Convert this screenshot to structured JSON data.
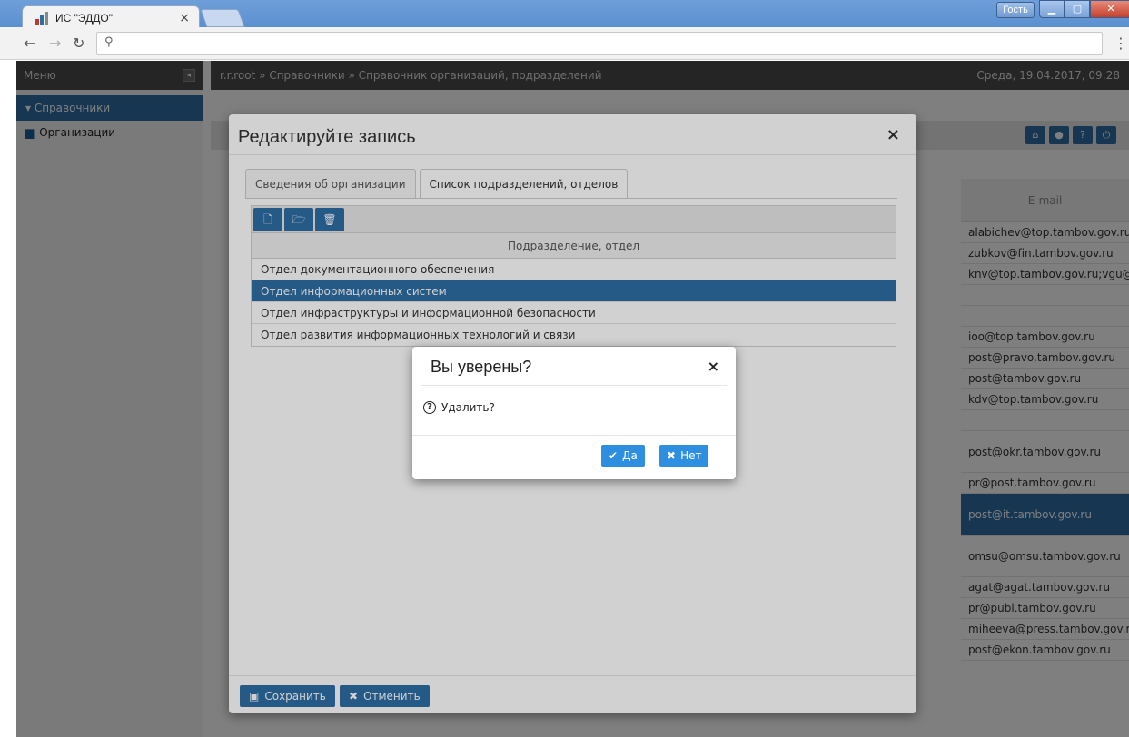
{
  "browser": {
    "tab_title": "ИС \"ЭДДО\"",
    "tab_close": "×",
    "guest": "Гость",
    "omnibox_value": ""
  },
  "sidebar": {
    "header": "Меню",
    "active_group": "▾ Справочники",
    "items": [
      {
        "label": "Организации"
      }
    ]
  },
  "header": {
    "breadcrumb": "r.r.root » Справочники » Справочник организаций, подразделений",
    "datetime": "Среда, 19.04.2017, 09:28"
  },
  "grid": {
    "email_header": "E-mail",
    "emails": [
      "alabichev@top.tambov.gov.ru",
      "zubkov@fin.tambov.gov.ru",
      "knv@top.tambov.gov.ru;vgu@to",
      "",
      "",
      "ioo@top.tambov.gov.ru",
      "post@pravo.tambov.gov.ru",
      "post@tambov.gov.ru",
      "kdv@top.tambov.gov.ru",
      "",
      "post@okr.tambov.gov.ru",
      "pr@post.tambov.gov.ru",
      "post@it.tambov.gov.ru",
      "omsu@omsu.tambov.gov.ru",
      "agat@agat.tambov.gov.ru",
      "pr@publ.tambov.gov.ru",
      "miheeva@press.tambov.gov.ru",
      "post@ekon.tambov.gov.ru"
    ]
  },
  "edit_modal": {
    "title": "Редактируйте запись",
    "close": "×",
    "tabs": [
      {
        "label": "Сведения об организации"
      },
      {
        "label": "Список подразделений, отделов"
      }
    ],
    "table_header": "Подразделение, отдел",
    "rows": [
      "Отдел документационного обеспечения",
      "Отдел информационных систем",
      "Отдел инфраструктуры и информационной безопасности",
      "Отдел развития информационных технологий и связи"
    ],
    "save": "Сохранить",
    "cancel": "Отменить"
  },
  "confirm": {
    "title": "Вы уверены?",
    "close": "×",
    "message": "Удалить?",
    "yes": "Да",
    "no": "Нет"
  },
  "colors": {
    "primary": "#2e6da4",
    "confirm_button": "#2e8fe0"
  }
}
